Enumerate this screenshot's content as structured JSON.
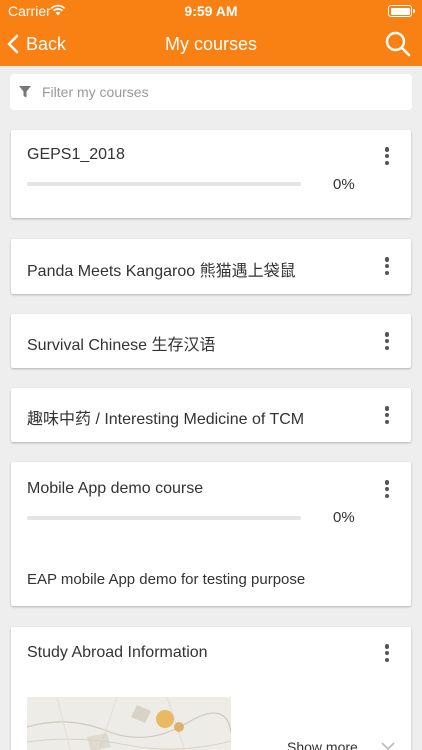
{
  "status_bar": {
    "carrier": "Carrier",
    "time": "9:59 AM"
  },
  "nav": {
    "back_label": "Back",
    "title": "My courses"
  },
  "filter": {
    "placeholder": "Filter my courses"
  },
  "courses": [
    {
      "title": "GEPS1_2018",
      "progress_text": "0%",
      "progress": 0
    },
    {
      "title": "Panda Meets Kangaroo 熊猫遇上袋鼠"
    },
    {
      "title": "Survival Chinese 生存汉语"
    },
    {
      "title": "趣味中药 / Interesting Medicine of TCM"
    },
    {
      "title": "Mobile App demo course",
      "progress_text": "0%",
      "progress": 0,
      "summary": "EAP mobile App demo for testing purpose"
    },
    {
      "title": "Study Abroad Information",
      "show_more_label": "Show more"
    }
  ],
  "colors": {
    "accent": "#f98012",
    "background": "#eeeeee"
  }
}
